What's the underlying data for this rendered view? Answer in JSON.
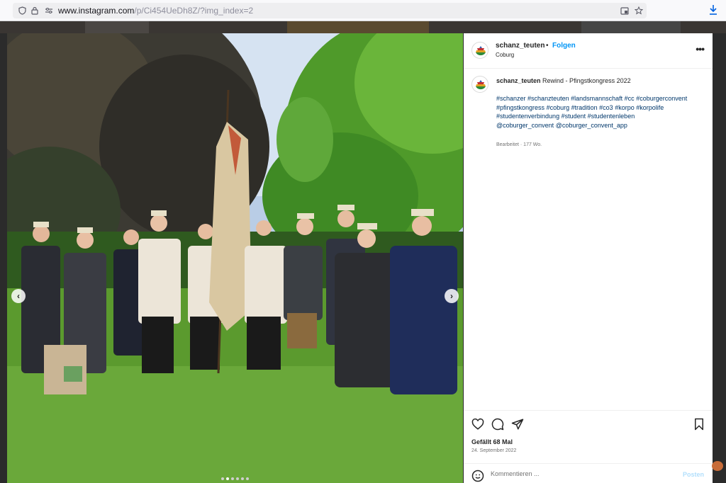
{
  "browser": {
    "url_host": "www.instagram.com",
    "url_path": "/p/Ci454UeDh8Z/?img_index=2",
    "icons": [
      "shield-icon",
      "lock-icon",
      "permissions-icon",
      "reader-view-icon",
      "bookmark-star-icon",
      "download-icon"
    ]
  },
  "post": {
    "username": "schanz_teuten",
    "separator": "•",
    "follow_label": "Folgen",
    "location": "Coburg",
    "caption_user": "schanz_teuten",
    "caption_text": "Rewind - Pfingstkongress 2022",
    "hashtags": [
      "#schanzer",
      "#schanzteuten",
      "#landsmannschaft",
      "#cc",
      "#coburgerconvent",
      "#pfingstkongress",
      "#coburg",
      "#tradition",
      "#co3",
      "#korpo",
      "#korpolife",
      "#studentenverbindung",
      "#student",
      "#studentenleben"
    ],
    "mentions": [
      "@coburger_convent",
      "@coburger_convent_app"
    ],
    "edited_label": "Bearbeitet",
    "edited_sep": "·",
    "age": "177 Wo.",
    "likes_label": "Gefällt 68 Mal",
    "date": "24. September 2022",
    "comment_placeholder": "Kommentieren ...",
    "post_button": "Posten"
  },
  "photo": {
    "prev_icon": "chevron-left-icon",
    "next_icon": "chevron-right-icon",
    "carousel_total": 6,
    "carousel_active_index": 2
  },
  "colors": {
    "accent": "#0095f6",
    "hashtag": "#00376b",
    "post_disabled": "#b2dffc",
    "secondary_text": "#737373"
  }
}
